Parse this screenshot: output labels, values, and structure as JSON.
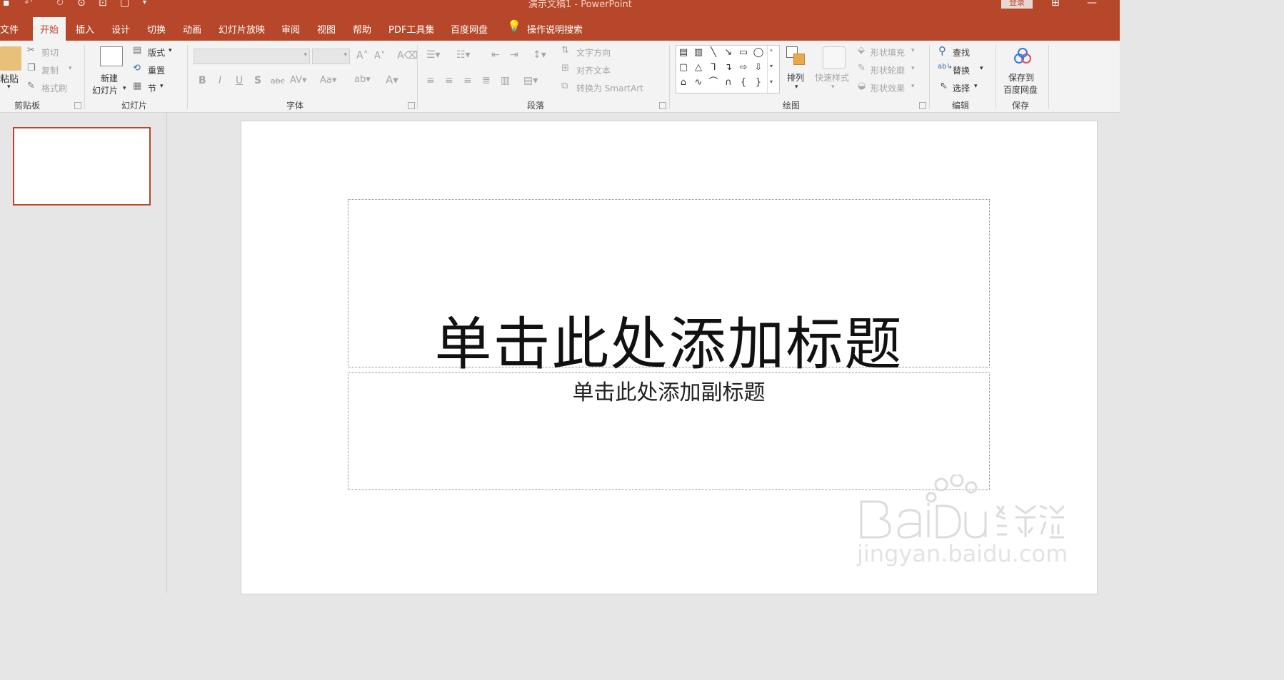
{
  "titlebar": {
    "title": "演示文稿1 - PowerPoint",
    "login_label": "登录"
  },
  "tabs": [
    "文件",
    "开始",
    "插入",
    "设计",
    "切换",
    "动画",
    "幻灯片放映",
    "审阅",
    "视图",
    "帮助",
    "PDF工具集",
    "百度网盘"
  ],
  "active_tab": "开始",
  "tell_me": "操作说明搜索",
  "ribbon": {
    "clipboard": {
      "label": "剪贴板",
      "paste": "粘贴",
      "cut": "剪切",
      "copy": "复制",
      "format_painter": "格式刷"
    },
    "slides": {
      "label": "幻灯片",
      "new_slide": "新建\n幻灯片",
      "new_slide_line1": "新建",
      "new_slide_line2": "幻灯片",
      "layout": "版式",
      "reset": "重置",
      "section": "节"
    },
    "font": {
      "label": "字体",
      "font_name": "",
      "font_size": ""
    },
    "paragraph": {
      "label": "段落",
      "text_direction": "文字方向",
      "align_text": "对齐文本",
      "convert_smartart": "转换为 SmartArt"
    },
    "drawing": {
      "label": "绘图",
      "arrange": "排列",
      "quick_styles": "快速样式",
      "shape_fill": "形状填充",
      "shape_outline": "形状轮廓",
      "shape_effects": "形状效果"
    },
    "editing": {
      "label": "编辑",
      "find": "查找",
      "replace": "替换",
      "select": "选择"
    },
    "save": {
      "label": "保存",
      "save_to_line1": "保存到",
      "save_to_line2": "百度网盘"
    }
  },
  "slide": {
    "title_placeholder": "单击此处添加标题",
    "subtitle_placeholder": "单击此处添加副标题"
  },
  "watermark": {
    "brand": "Baidu经验",
    "url": "jingyan.baidu.com"
  },
  "colors": {
    "accent": "#b7472a",
    "ribbon_bg": "#f3f3f3",
    "workspace_bg": "#e6e6e6"
  }
}
